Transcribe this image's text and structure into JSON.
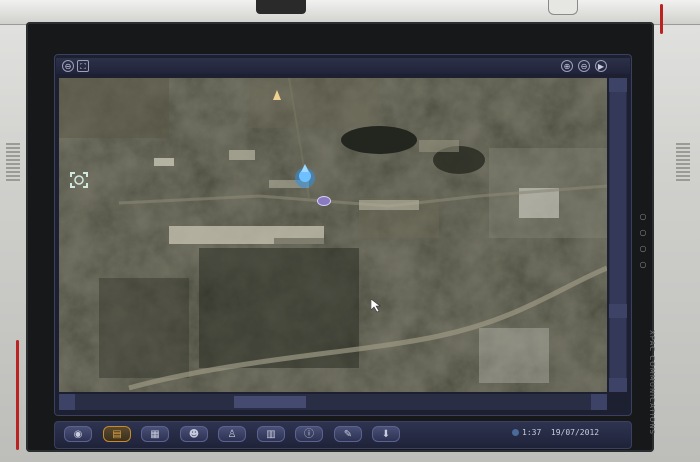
{
  "device": {
    "side_label": "XPAC COMMUNICATIONS"
  },
  "map_toolbar": {
    "left_buttons": [
      {
        "name": "minus-icon",
        "glyph": "⊖"
      },
      {
        "name": "fit-view-icon",
        "glyph": "⛶"
      }
    ],
    "right_buttons": [
      {
        "name": "zoom-in-icon",
        "glyph": "⊕"
      },
      {
        "name": "zoom-out-icon",
        "glyph": "⊖"
      },
      {
        "name": "play-icon",
        "glyph": "▶"
      }
    ]
  },
  "map": {
    "markers": [
      {
        "name": "player-marker-icon",
        "color": "#2f8fe0"
      },
      {
        "name": "target-bracket-icon",
        "color": "#cfe9e0"
      },
      {
        "name": "north-arrow-icon",
        "color": "#f0d090"
      },
      {
        "name": "mouse-cursor-icon",
        "color": "#ffffff"
      }
    ]
  },
  "taskbar": {
    "buttons": [
      {
        "name": "globe-icon",
        "glyph": "◉",
        "active": false
      },
      {
        "name": "map-icon",
        "glyph": "▤",
        "active": true
      },
      {
        "name": "calendar-icon",
        "glyph": "▦",
        "active": false
      },
      {
        "name": "team-icon",
        "glyph": "☻",
        "active": false
      },
      {
        "name": "person-icon",
        "glyph": "♙",
        "active": false
      },
      {
        "name": "stats-icon",
        "glyph": "▥",
        "active": false
      },
      {
        "name": "info-icon",
        "glyph": "ⓘ",
        "active": false
      },
      {
        "name": "wrench-icon",
        "glyph": "✎",
        "active": false
      },
      {
        "name": "download-icon",
        "glyph": "⬇",
        "active": false
      }
    ],
    "time": "1:37",
    "date": "19/07/2012"
  },
  "colors": {
    "accent": "#e1a23e",
    "ui_panel": "#2d3148",
    "bezel": "#161819"
  }
}
